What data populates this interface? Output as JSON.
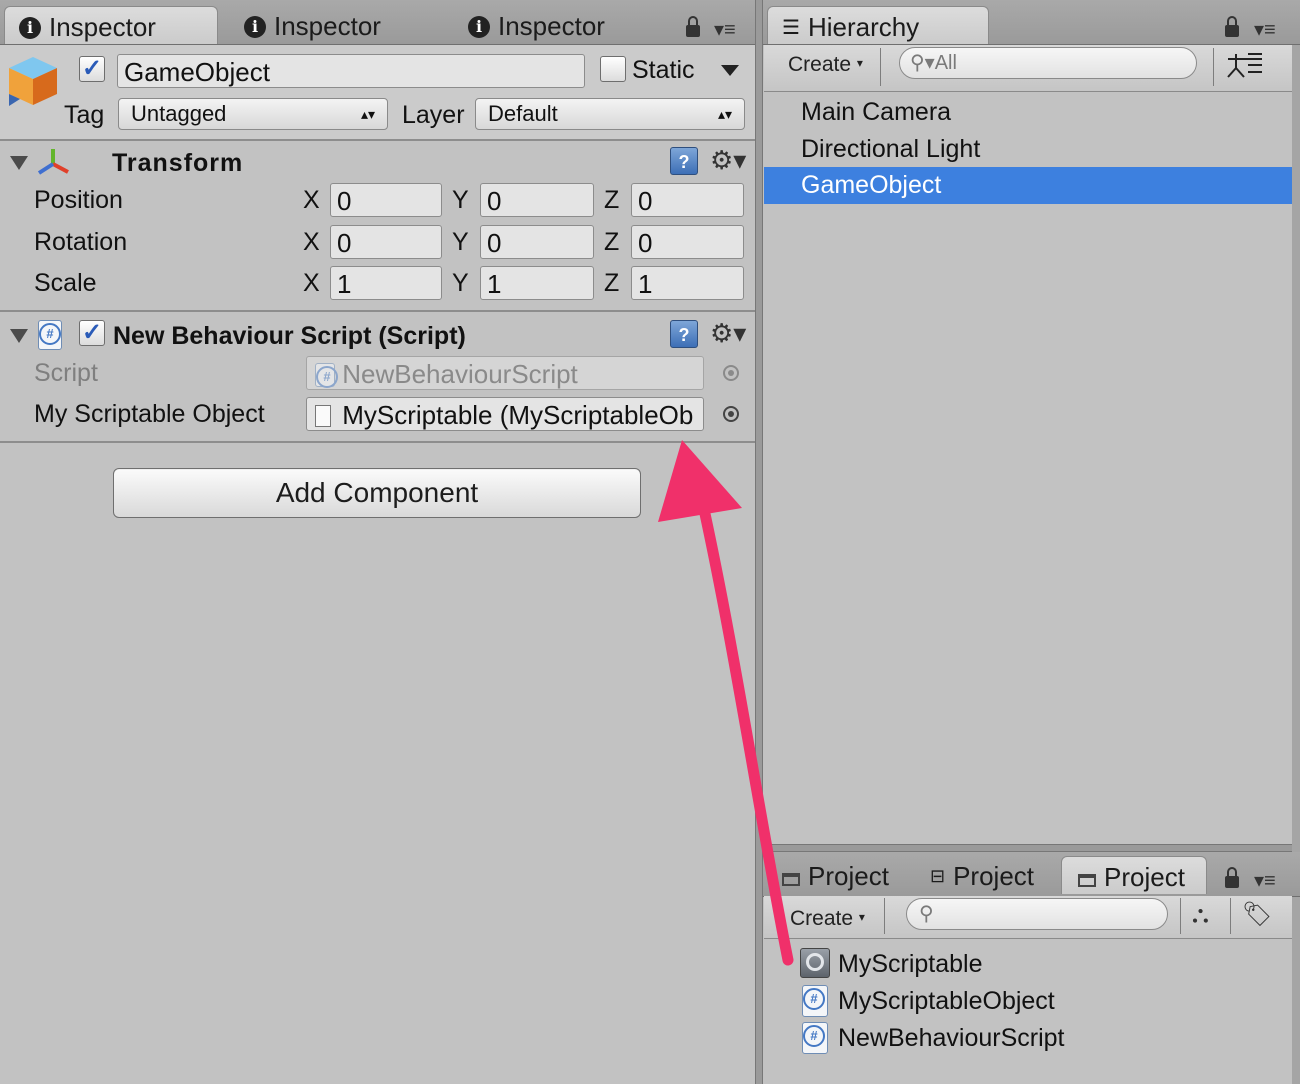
{
  "inspector": {
    "tabs": [
      "Inspector",
      "Inspector",
      "Inspector"
    ],
    "object_name": "GameObject",
    "active_checked": true,
    "static_label": "Static",
    "tag_label": "Tag",
    "tag_value": "Untagged",
    "layer_label": "Layer",
    "layer_value": "Default",
    "transform": {
      "title": "Transform",
      "rows": [
        {
          "label": "Position",
          "x": "0",
          "y": "0",
          "z": "0"
        },
        {
          "label": "Rotation",
          "x": "0",
          "y": "0",
          "z": "0"
        },
        {
          "label": "Scale",
          "x": "1",
          "y": "1",
          "z": "1"
        }
      ],
      "axis_x": "X",
      "axis_y": "Y",
      "axis_z": "Z"
    },
    "script_component": {
      "title": "New Behaviour Script (Script)",
      "script_label": "Script",
      "script_value": "NewBehaviourScript",
      "field_label": "My Scriptable Object",
      "field_value": "MyScriptable (MyScriptableOb"
    },
    "add_component": "Add Component"
  },
  "hierarchy": {
    "tab": "Hierarchy",
    "create": "Create",
    "search_placeholder": "All",
    "items": [
      "Main Camera",
      "Directional Light",
      "GameObject"
    ],
    "selected_index": 2
  },
  "project": {
    "tabs": [
      "Project",
      "Project",
      "Project"
    ],
    "create": "Create",
    "items": [
      "MyScriptable",
      "MyScriptableObject",
      "NewBehaviourScript"
    ]
  },
  "colors": {
    "selection": "#3d80df",
    "arrow": "#f0306a"
  }
}
